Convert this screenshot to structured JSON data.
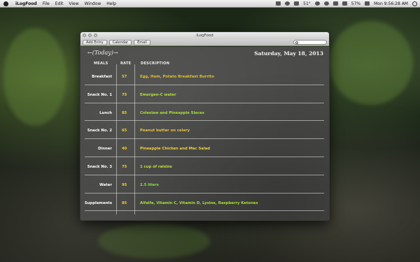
{
  "menubar": {
    "app_name": "iLogFood",
    "items": [
      "File",
      "Edit",
      "View",
      "Window",
      "Help"
    ],
    "temperature": "51°",
    "battery": "57%",
    "clock": "Mon 9:56:28 AM"
  },
  "window": {
    "title": "iLogFood",
    "toolbar": {
      "add_entry": "Add Entry",
      "calendar": "Calendar",
      "email": "Email",
      "search_placeholder": ""
    }
  },
  "log": {
    "prev_arrow": "←",
    "today_label": "(Today)",
    "next_arrow": "→",
    "date": "Saturday, May 18, 2013",
    "headers": {
      "meals": "MEALS",
      "rate": "RATE",
      "description": "DESCRIPTION"
    },
    "rows": [
      {
        "meal": "Breakfast",
        "rate": "57",
        "description": "Egg, Ham, Potato Breakfast Burrito",
        "color": "#e0c030"
      },
      {
        "meal": "Snack No. 1",
        "rate": "75",
        "description": "Emergen-C water",
        "color": "#b4e23a"
      },
      {
        "meal": "Lunch",
        "rate": "85",
        "description": "Coleslaw and Pineapple Slaces",
        "color": "#a8e03a"
      },
      {
        "meal": "Snack No. 2",
        "rate": "65",
        "description": "Peanut butter on celery",
        "color": "#e8c53a"
      },
      {
        "meal": "Dinner",
        "rate": "40",
        "description": "Pineapple Chicken and Mac Salad",
        "color": "#f0d23a"
      },
      {
        "meal": "Snack No. 3",
        "rate": "75",
        "description": "1 cup of raisins",
        "color": "#c0e03a"
      },
      {
        "meal": "Water",
        "rate": "95",
        "description": "2.5 liters",
        "color": "#8ee03a"
      },
      {
        "meal": "Supplements",
        "rate": "85",
        "description": "Alfalfa, Vitamin C, Vitamin D, Lysine, Raspberry Ketones",
        "color": "#a8e03a"
      }
    ]
  }
}
